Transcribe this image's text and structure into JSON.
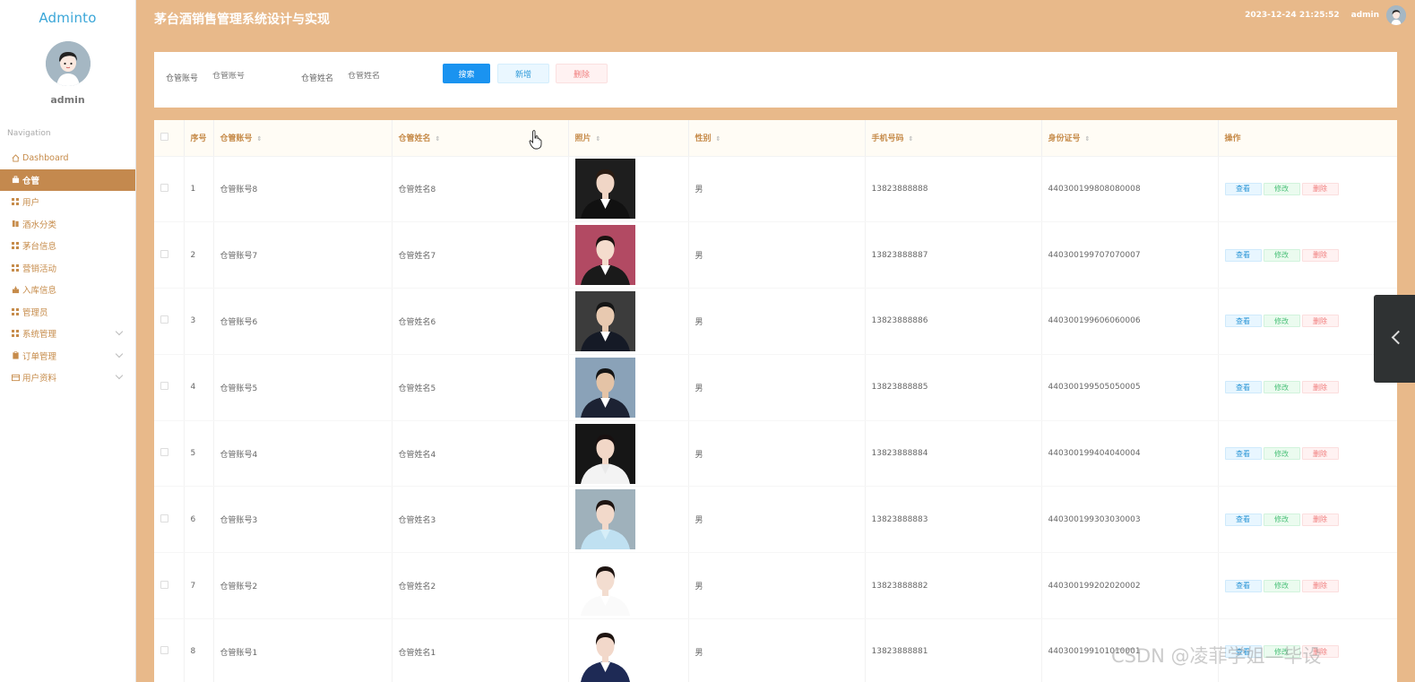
{
  "app": {
    "logo": "Adminto",
    "title": "茅台酒销售管理系统设计与实现"
  },
  "sidebar": {
    "username": "admin",
    "nav_title": "Navigation",
    "items": [
      {
        "label": "Dashboard",
        "icon": "home-icon"
      },
      {
        "label": "仓管",
        "icon": "briefcase-icon",
        "active": true
      },
      {
        "label": "用户",
        "icon": "grid-icon"
      },
      {
        "label": "酒水分类",
        "icon": "book-icon"
      },
      {
        "label": "茅台信息",
        "icon": "grid-icon"
      },
      {
        "label": "营销活动",
        "icon": "grid-icon"
      },
      {
        "label": "入库信息",
        "icon": "inbox-icon"
      },
      {
        "label": "管理员",
        "icon": "grid-icon"
      },
      {
        "label": "系统管理",
        "icon": "grid-icon",
        "expandable": true
      },
      {
        "label": "订单管理",
        "icon": "clipboard-icon",
        "expandable": true
      },
      {
        "label": "用户资料",
        "icon": "card-icon",
        "expandable": true
      }
    ]
  },
  "header": {
    "datetime": "2023-12-24 21:25:52",
    "user": "admin"
  },
  "search": {
    "account_label": "仓管账号",
    "account_placeholder": "仓管账号",
    "name_label": "仓管姓名",
    "name_placeholder": "仓管姓名",
    "search_button": "搜索",
    "add_button": "新增",
    "delete_button": "删除"
  },
  "table": {
    "columns": [
      "序号",
      "仓管账号",
      "仓管姓名",
      "照片",
      "性别",
      "手机号码",
      "身份证号",
      "操作"
    ],
    "action_labels": {
      "view": "查看",
      "edit": "修改",
      "delete": "删除"
    },
    "rows": [
      {
        "index": "1",
        "account": "仓管账号8",
        "name": "仓管姓名8",
        "gender": "男",
        "phone": "13823888888",
        "id_number": "440300199808080008"
      },
      {
        "index": "2",
        "account": "仓管账号7",
        "name": "仓管姓名7",
        "gender": "男",
        "phone": "13823888887",
        "id_number": "440300199707070007"
      },
      {
        "index": "3",
        "account": "仓管账号6",
        "name": "仓管姓名6",
        "gender": "男",
        "phone": "13823888886",
        "id_number": "440300199606060006"
      },
      {
        "index": "4",
        "account": "仓管账号5",
        "name": "仓管姓名5",
        "gender": "男",
        "phone": "13823888885",
        "id_number": "440300199505050005"
      },
      {
        "index": "5",
        "account": "仓管账号4",
        "name": "仓管姓名4",
        "gender": "男",
        "phone": "13823888884",
        "id_number": "440300199404040004"
      },
      {
        "index": "6",
        "account": "仓管账号3",
        "name": "仓管姓名3",
        "gender": "男",
        "phone": "13823888883",
        "id_number": "440300199303030003"
      },
      {
        "index": "7",
        "account": "仓管账号2",
        "name": "仓管姓名2",
        "gender": "男",
        "phone": "13823888882",
        "id_number": "440300199202020002"
      },
      {
        "index": "8",
        "account": "仓管账号1",
        "name": "仓管姓名1",
        "gender": "男",
        "phone": "13823888881",
        "id_number": "440300199101010001"
      }
    ]
  },
  "watermark": "CSDN @凌菲学姐—毕设",
  "colors": {
    "accent": "#c4894e",
    "header_bg": "#e8b98a",
    "primary_button": "#1a93f0"
  }
}
